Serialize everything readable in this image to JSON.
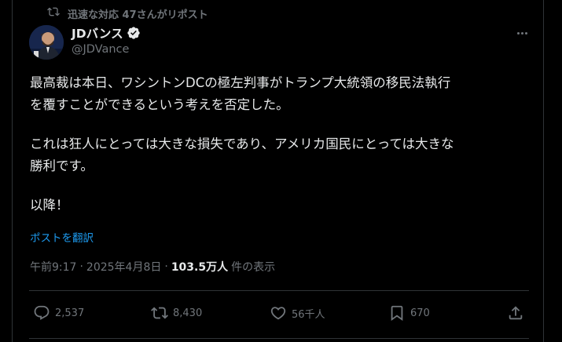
{
  "repost_banner": {
    "text": "迅速な対応 47さんがリポスト",
    "icon": "repost-icon"
  },
  "author": {
    "display_name": "JDバンス",
    "handle": "@JDVance",
    "verified": true
  },
  "post": {
    "lines": [
      "最高裁は本日、ワシントンDCの極左判事がトランプ大統領の移民法執行",
      "を覆すことができるという考えを否定した。",
      "",
      "これは狂人にとっては大きな損失であり、アメリカ国民にとっては大きな",
      "勝利です。",
      "",
      "以降！"
    ],
    "translate_label": "ポストを翻訳"
  },
  "meta": {
    "time": "午前9:17",
    "separator": "·",
    "date": "2025年4月8日",
    "separator2": "·",
    "views": "103.5万人",
    "views_suffix": "件の表示"
  },
  "actions": {
    "replies": "2,537",
    "reposts": "8,430",
    "likes": "56千人",
    "bookmarks": "670"
  },
  "colors": {
    "accent": "#1d9bf0",
    "muted": "#71767b",
    "text": "#e7e9ea",
    "background": "#000000",
    "border": "#2f3336"
  }
}
